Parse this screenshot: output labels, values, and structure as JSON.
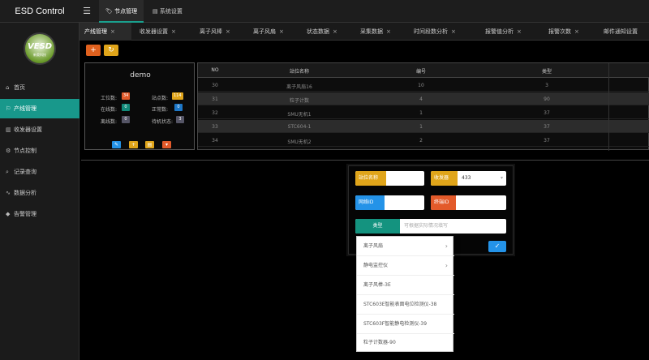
{
  "app": {
    "title": "ESD Control"
  },
  "top_tabs": [
    {
      "label": "节点管理",
      "icon": "tag-icon"
    },
    {
      "label": "系统设置",
      "icon": "grid-icon"
    }
  ],
  "sidebar": {
    "logo_text": "VESD",
    "logo_sub": "新奥科技",
    "items": [
      {
        "label": "首页",
        "icon": "home-icon"
      },
      {
        "label": "产线管理",
        "icon": "flag-icon"
      },
      {
        "label": "收发器设置",
        "icon": "bars-icon"
      },
      {
        "label": "节点控制",
        "icon": "gear-icon"
      },
      {
        "label": "记录查询",
        "icon": "search-icon"
      },
      {
        "label": "数据分析",
        "icon": "chart-icon"
      },
      {
        "label": "告警管理",
        "icon": "bell-icon"
      }
    ]
  },
  "page_tabs": [
    {
      "label": "产线管理",
      "close": "×"
    },
    {
      "label": "收发器设置",
      "close": "×"
    },
    {
      "label": "离子风棒",
      "close": "×"
    },
    {
      "label": "离子风扇",
      "close": "×"
    },
    {
      "label": "状态数据",
      "close": "×"
    },
    {
      "label": "采集数据",
      "close": "×"
    },
    {
      "label": "时间段数分析",
      "close": "×"
    },
    {
      "label": "报警值分析",
      "close": "×"
    },
    {
      "label": "报警次数",
      "close": "×"
    },
    {
      "label": "邮件通知设置",
      "close": ""
    }
  ],
  "toolbar": {
    "add": "+",
    "refresh": "↻"
  },
  "line_panel": {
    "title": "demo",
    "stats": [
      {
        "label": "工位数:",
        "value": "34"
      },
      {
        "label": "站点数:",
        "value": "114"
      },
      {
        "label": "在线数:",
        "value": "0"
      },
      {
        "label": "正常数:",
        "value": "0"
      },
      {
        "label": "离线数:",
        "value": "0"
      },
      {
        "label": "待机状态:",
        "value": "3"
      }
    ],
    "buttons": [
      "✎",
      "+",
      "▤",
      "▾"
    ]
  },
  "table": {
    "headers": [
      "NO",
      "站位名称",
      "编号",
      "类型"
    ],
    "rows": [
      [
        "30",
        "离子风扇16",
        "10",
        "3"
      ],
      [
        "31",
        "粒子计数",
        "4",
        "90"
      ],
      [
        "32",
        "SMU无机1",
        "1",
        "37"
      ],
      [
        "33",
        "STC604-1",
        "1",
        "37"
      ],
      [
        "34",
        "SMU无机2",
        "2",
        "37"
      ]
    ]
  },
  "dialog": {
    "station_name_label": "站位名称",
    "transceiver_label": "收发器",
    "transceiver_value": "433",
    "transceiver_caret": "▾",
    "network_id_label": "网络ID",
    "terminal_id_label": "终端ID",
    "type_label": "类型",
    "type_placeholder": "可根据实际情况填写",
    "confirm": "✓"
  },
  "dropdown": {
    "items": [
      {
        "label": "离子风扇",
        "arrow": "›"
      },
      {
        "label": "静电监控仪",
        "arrow": "›"
      },
      {
        "label": "离子风棒-3E",
        "arrow": ""
      },
      {
        "label": "STC603E智能表面电位检测仪-38",
        "arrow": ""
      },
      {
        "label": "STC603F智能静电检测仪-39",
        "arrow": ""
      },
      {
        "label": "粒子计数器-90",
        "arrow": ""
      }
    ]
  }
}
